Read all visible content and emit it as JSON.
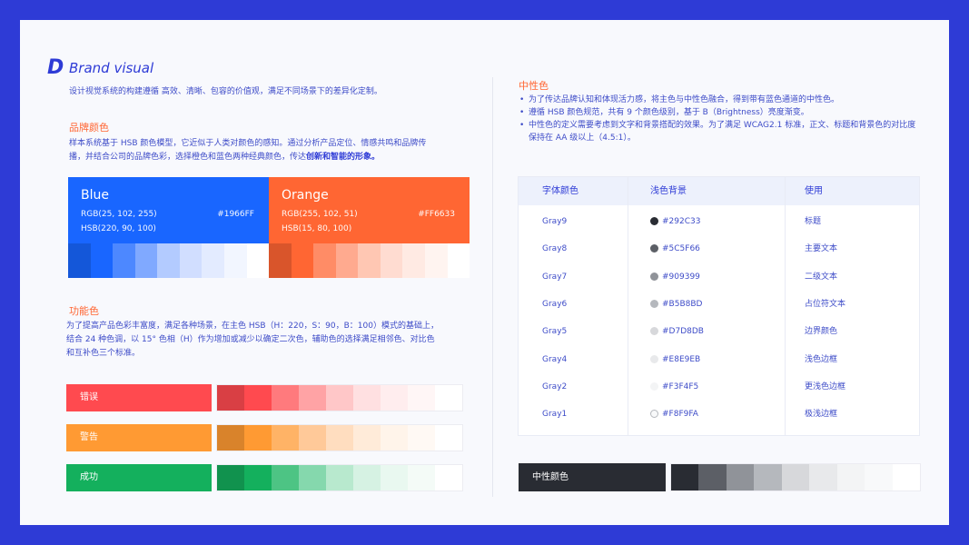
{
  "header": {
    "logo_letter": "D",
    "title": "Brand visual",
    "subtitle": "设计视觉系统的构建遵循 高效、清晰、包容的价值观，满足不同场景下的差异化定制。"
  },
  "brand_colors": {
    "heading": "品牌颜色",
    "desc_line1": "样本系统基于 HSB 颜色模型，它近似于人类对颜色的感知。通过分析产品定位、情感共鸣和品牌传",
    "desc_line2_a": "播，并结合公司的品牌色彩，选择橙色和蓝色两种经典颜色，传达",
    "desc_line2_b": "创新和智能的形象。",
    "blue": {
      "name": "Blue",
      "rgb": "RGB(25, 102, 255)",
      "hsb": "HSB(220, 90, 100)",
      "hex": "#1966FF",
      "color": "#1966FF",
      "shades": [
        "#1457D9",
        "#1966FF",
        "#4D88FF",
        "#80A9FF",
        "#B3CBFF",
        "#D1DEFF",
        "#E3EBFF",
        "#F2F6FF",
        "#FFFFFF"
      ]
    },
    "orange": {
      "name": "Orange",
      "rgb": "RGB(255, 102, 51)",
      "hsb": "HSB(15, 80, 100)",
      "hex": "#FF6633",
      "color": "#FF6633",
      "shades": [
        "#D9552B",
        "#FF6633",
        "#FF8C66",
        "#FFAA8F",
        "#FFC7B3",
        "#FFDCD1",
        "#FFEAE3",
        "#FFF4F0",
        "#FFFFFF"
      ]
    }
  },
  "function_colors": {
    "heading": "功能色",
    "desc_line1": "为了提高产品色彩丰富度，满足各种场景，在主色 HSB（H：220，S：90，B：100）模式的基础上，",
    "desc_line2": "结合 24 种色调，以 15° 色相（H）作为增加或减少以确定二次色，辅助色的选择满足相邻色、对比色",
    "desc_line3": "和互补色三个标准。",
    "items": [
      {
        "label": "错误",
        "color": "#FF4A4F",
        "shades": [
          "#D93F44",
          "#FF4A4F",
          "#FF7A7D",
          "#FFA3A5",
          "#FFC7C8",
          "#FFE0E1",
          "#FFEDEE",
          "#FFF6F6",
          "#FFFFFF"
        ]
      },
      {
        "label": "警告",
        "color": "#FF9A33",
        "shades": [
          "#D9832B",
          "#FF9A33",
          "#FFB366",
          "#FFC999",
          "#FFDDBF",
          "#FFEBD9",
          "#FFF4EA",
          "#FFF9F4",
          "#FFFFFF"
        ]
      },
      {
        "label": "成功",
        "color": "#14B05D",
        "shades": [
          "#11924E",
          "#14B05D",
          "#4DC484",
          "#85D8AD",
          "#B8E9CE",
          "#D6F2E3",
          "#E9F8F0",
          "#F4FBF7",
          "#FFFFFF"
        ]
      }
    ]
  },
  "neutral": {
    "heading": "中性色",
    "bullets": [
      "为了传达品牌认知和体现活力感，将主色与中性色融合，得到带有蓝色通道的中性色。",
      "遵循 HSB 颜色规范，共有 9 个颜色级别，基于 B（Brightness）亮度渐变。",
      "中性色的定义需要考虑到文字和背景搭配的效果。为了满足 WCAG2.1 标准，正文、标题和背景色的对比度保持在 AA 级以上（4.5:1）。"
    ],
    "table": {
      "headers": [
        "字体颜色",
        "浅色背景",
        "使用"
      ],
      "rows": [
        {
          "name": "Gray9",
          "hex": "#292C33",
          "usage": "标题"
        },
        {
          "name": "Gray8",
          "hex": "#5C5F66",
          "usage": "主要文本"
        },
        {
          "name": "Gray7",
          "hex": "#909399",
          "usage": "二级文本"
        },
        {
          "name": "Gray6",
          "hex": "#B5B8BD",
          "usage": "占位符文本"
        },
        {
          "name": "Gray5",
          "hex": "#D7D8DB",
          "usage": "边界颜色"
        },
        {
          "name": "Gray4",
          "hex": "#E8E9EB",
          "usage": "浅色边框"
        },
        {
          "name": "Gray2",
          "hex": "#F3F4F5",
          "usage": "更浅色边框"
        },
        {
          "name": "Gray1",
          "hex": "#F8F9FA",
          "usage": "极浅边框"
        }
      ]
    },
    "strip_label": "中性颜色",
    "strip_shades": [
      "#292C33",
      "#5C5F66",
      "#909399",
      "#B5B8BD",
      "#D7D8DB",
      "#E8E9EB",
      "#F3F4F5",
      "#F8F9FA",
      "#FFFFFF"
    ]
  },
  "colors": {
    "accent": "#2E3BD6",
    "heading": "#FF6633",
    "frame": "#2E3BD6"
  }
}
